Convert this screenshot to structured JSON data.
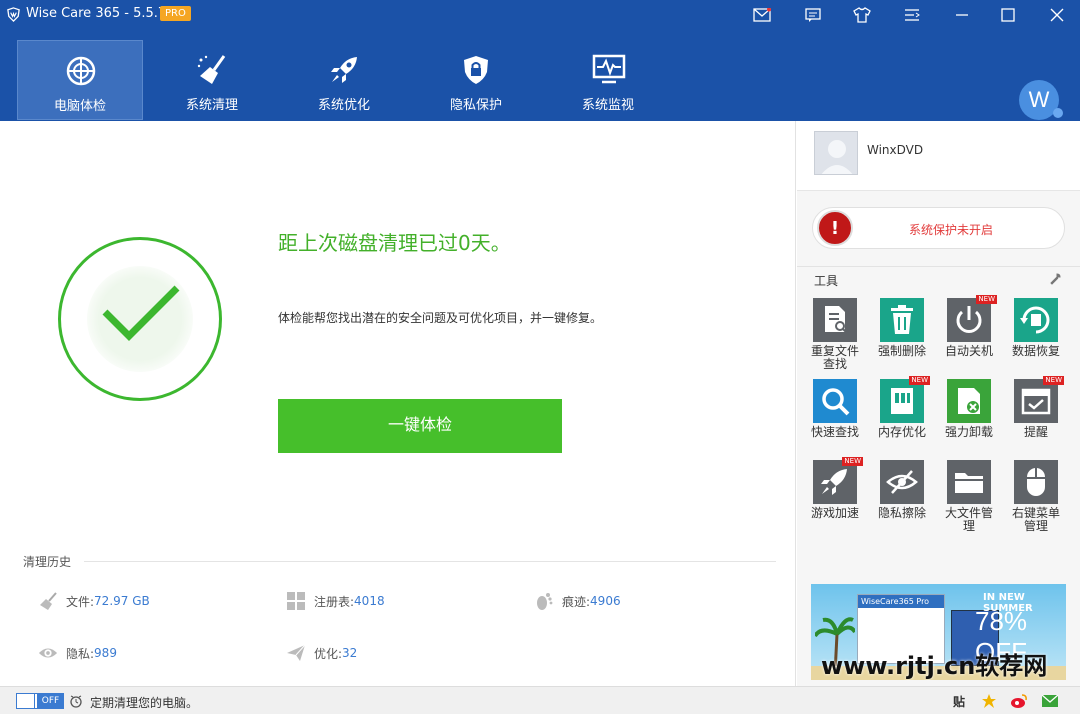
{
  "titlebar": {
    "title": "Wise Care 365 - 5.5.7",
    "badge": "PRO",
    "icons": [
      "mail-icon",
      "feedback-icon",
      "skin-icon",
      "menu-icon",
      "minimize-icon",
      "maximize-icon",
      "close-icon"
    ]
  },
  "nav": {
    "tabs": [
      {
        "label": "电脑体检",
        "icon": "pc-check-icon"
      },
      {
        "label": "系统清理",
        "icon": "broom-icon"
      },
      {
        "label": "系统优化",
        "icon": "rocket-icon"
      },
      {
        "label": "隐私保护",
        "icon": "shield-lock-icon"
      },
      {
        "label": "系统监视",
        "icon": "monitor-icon"
      }
    ],
    "account_letter": "W"
  },
  "main": {
    "headline": "距上次磁盘清理已过0天。",
    "description": "体检能帮您找出潜在的安全问题及可优化项目，并一键修复。",
    "scan_button": "一键体检",
    "history_title": "清理历史",
    "stats": [
      {
        "label": "文件: ",
        "value": "72.97 GB"
      },
      {
        "label": "注册表: ",
        "value": "4018"
      },
      {
        "label": "痕迹: ",
        "value": "4906"
      },
      {
        "label": "隐私: ",
        "value": "989"
      },
      {
        "label": "优化: ",
        "value": "32"
      }
    ]
  },
  "sidebar": {
    "username": "WinxDVD",
    "protection_status": "系统保护未开启",
    "tools_title": "工具",
    "tools": [
      {
        "label": "重复文件查找",
        "color": "#5f6368",
        "new": false
      },
      {
        "label": "强制删除",
        "color": "#1aa58a",
        "new": false
      },
      {
        "label": "自动关机",
        "color": "#5f6368",
        "new": true
      },
      {
        "label": "数据恢复",
        "color": "#1aa58a",
        "new": false
      },
      {
        "label": "快速查找",
        "color": "#1f8ad0",
        "new": false
      },
      {
        "label": "内存优化",
        "color": "#1aa58a",
        "new": true
      },
      {
        "label": "强力卸载",
        "color": "#3aa43a",
        "new": false
      },
      {
        "label": "提醒",
        "color": "#5f6368",
        "new": true
      },
      {
        "label": "游戏加速",
        "color": "#5f6368",
        "new": true
      },
      {
        "label": "隐私擦除",
        "color": "#5f6368",
        "new": false
      },
      {
        "label": "大文件管理",
        "color": "#5f6368",
        "new": false
      },
      {
        "label": "右键菜单管理",
        "color": "#5f6368",
        "new": false
      }
    ],
    "new_badge": "NEW",
    "ad": {
      "headline": "IN NEW SUMMER",
      "discount": "78% OFF",
      "product": "WiseCare365 Pro"
    },
    "watermark": "www.rjtj.cn软荐网"
  },
  "statusbar": {
    "toggle": "OFF",
    "text": "定期清理您的电脑。",
    "icons": [
      "share-icon",
      "star-icon",
      "weibo-icon",
      "email-icon"
    ],
    "share_label": "贴"
  },
  "colors": {
    "brand_blue": "#1b52a8",
    "success_green": "#43b02a",
    "button_green": "#46bf2b",
    "value_blue": "#3b7bd1",
    "warning_red": "#c01818"
  }
}
